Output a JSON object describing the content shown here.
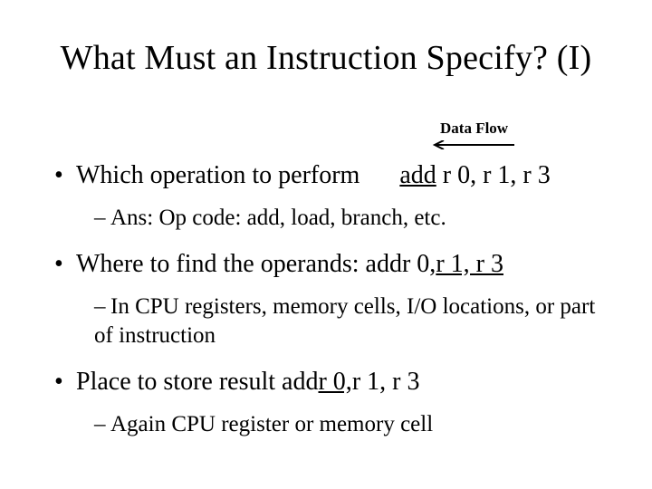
{
  "title": "What Must an Instruction Specify? (I)",
  "dataFlowLabel": "Data Flow",
  "bullets": {
    "b1": {
      "text": "Which operation to perform",
      "expr_op": "add",
      "expr_rest": " r 0, r 1, r 3",
      "sub": "Ans: Op code: add, load, branch, etc."
    },
    "b2": {
      "text_a": "Where to find the operands: add ",
      "text_b": "r 0,",
      "text_c": " r 1, r 3",
      "sub": "In CPU registers, memory cells, I/O locations, or part of instruction"
    },
    "b3": {
      "text_a": "Place to store result  add ",
      "text_b": "r 0,",
      "text_c": " r 1, r 3",
      "sub": "Again CPU register or memory cell"
    }
  },
  "symbols": {
    "bullet": "•",
    "dash": "–"
  }
}
